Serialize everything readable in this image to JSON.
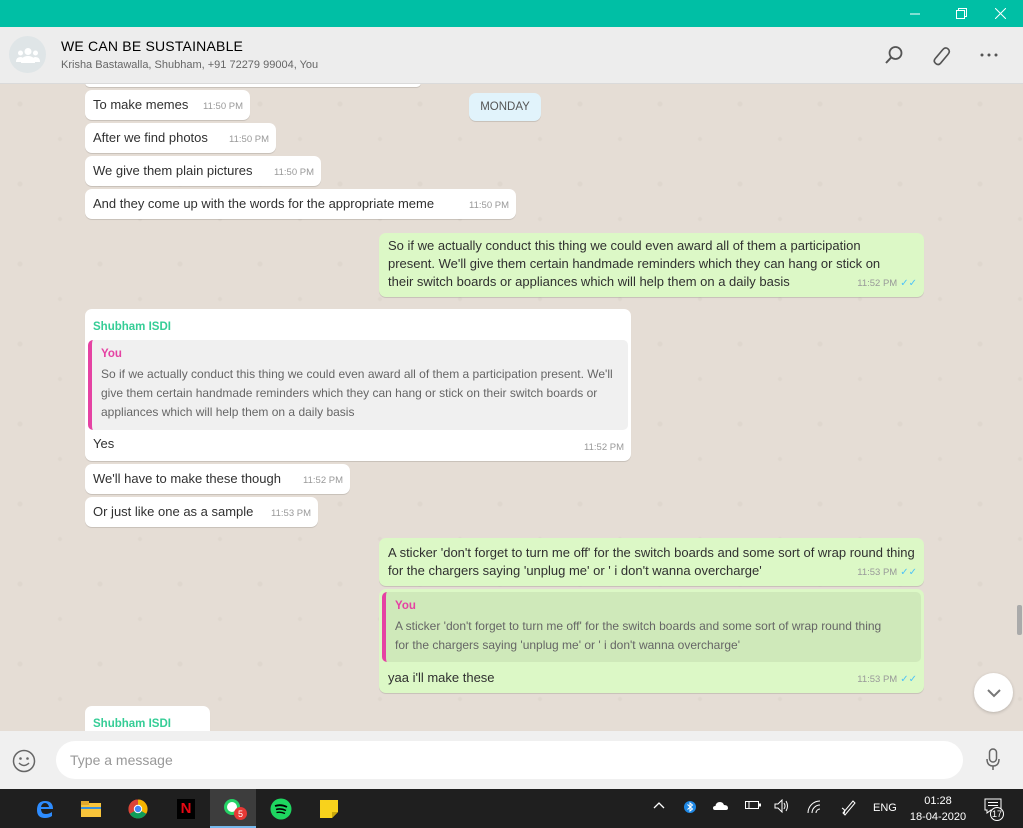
{
  "window": {
    "minimize_icon": "minimize-icon",
    "restore_icon": "restore-icon",
    "close_icon": "close-icon",
    "accent": "#00bfa5"
  },
  "header": {
    "title": "WE CAN BE SUSTAINABLE",
    "participants": "Krisha Bastawalla, Shubham, +91 72279 99004, You"
  },
  "chat": {
    "day_label": "MONDAY",
    "messages": [
      {
        "text": "To make memes",
        "time": "11:50 PM"
      },
      {
        "text": "After we find photos",
        "time": "11:50 PM"
      },
      {
        "text": "We give them plain pictures",
        "time": "11:50 PM"
      },
      {
        "text": "And they come up with the words for the appropriate meme",
        "time": "11:50 PM"
      },
      {
        "text": "So if we actually conduct this thing we could even award all of them a participation present. We'll give them certain handmade reminders which they can hang or stick on their switch boards or appliances which will help them on a daily basis",
        "time": "11:52 PM"
      },
      {
        "sender": "Shubham ISDI",
        "quote_name": "You",
        "quote_text": "So if we actually conduct this thing we could even award all of them a participation present. We'll give them certain handmade reminders which they can hang or stick on their switch boards or appliances which will help them on a daily basis",
        "text": "Yes",
        "time": "11:52 PM"
      },
      {
        "text": "We'll have to make these though",
        "time": "11:52 PM"
      },
      {
        "text": "Or just like one as a sample",
        "time": "11:53 PM"
      },
      {
        "text": "A sticker 'don't forget to turn me off' for the switch boards and some sort of wrap round thing for the chargers saying 'unplug me' or ' i don't wanna overcharge'",
        "time": "11:53 PM"
      },
      {
        "quote_name": "You",
        "quote_text": "A sticker 'don't forget to turn me off' for the switch boards and some sort of wrap round thing for the chargers saying 'unplug me' or ' i don't wanna overcharge'",
        "text": "yaa i'll make these",
        "time": "11:53 PM"
      },
      {
        "sender": "Shubham ISDI"
      }
    ]
  },
  "compose": {
    "placeholder": "Type a message"
  },
  "taskbar": {
    "badge_count": "5",
    "language": "ENG",
    "time": "01:28",
    "date": "18-04-2020",
    "notification_count": "17"
  }
}
